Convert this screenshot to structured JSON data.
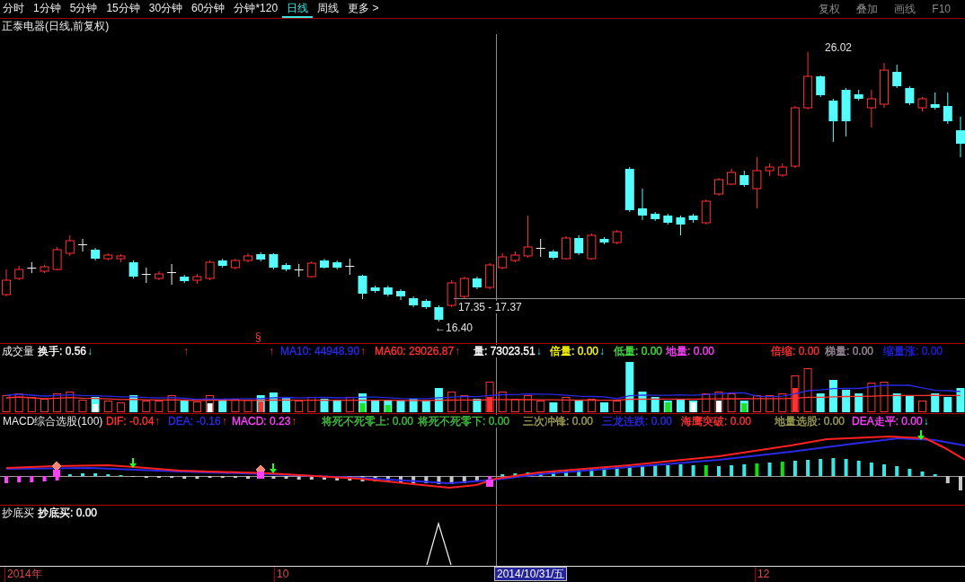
{
  "timeframe_tabs": [
    {
      "label": "分时",
      "selected": false
    },
    {
      "label": "1分钟",
      "selected": false
    },
    {
      "label": "5分钟",
      "selected": false
    },
    {
      "label": "15分钟",
      "selected": false
    },
    {
      "label": "30分钟",
      "selected": false
    },
    {
      "label": "60分钟",
      "selected": false
    },
    {
      "label": "分钟*120",
      "selected": false
    },
    {
      "label": "日线",
      "selected": true
    },
    {
      "label": "周线",
      "selected": false
    },
    {
      "label": "更多 >",
      "selected": false
    }
  ],
  "toolbar_buttons": [
    "复权",
    "叠加",
    "画线",
    "F10"
  ],
  "price_panel": {
    "title": "正泰电器(日线,前复权)",
    "high_label": "26.02",
    "crosshair_price": "17.35 - 17.37",
    "low_label": "←16.40",
    "signal_mark": "§"
  },
  "volume_panel": {
    "title": "成交量",
    "readouts": [
      {
        "kind": "value",
        "text": "换手: 0.56",
        "color": "#ffffff",
        "arrow": {
          "symbol": "↓",
          "rising": false
        }
      },
      {
        "kind": "marker",
        "arrow": {
          "symbol": "↑",
          "rising": true
        }
      },
      {
        "kind": "marker",
        "arrow": {
          "symbol": "↑",
          "rising": true
        }
      },
      {
        "kind": "value",
        "text": "MA10: 44948.90",
        "color": "#2a2ae6",
        "arrow": {
          "symbol": "↑",
          "rising": true
        }
      },
      {
        "kind": "value",
        "text": "MA60: 29026.87",
        "color": "#ff3232",
        "arrow": {
          "symbol": "↑",
          "rising": true
        }
      },
      {
        "kind": "value",
        "text": "量: 73023.51",
        "color": "#ffffff",
        "arrow": {
          "symbol": "↓",
          "rising": false
        }
      },
      {
        "kind": "value",
        "text": "倍量: 0.00",
        "color": "#ffff00",
        "arrow": {
          "symbol": "↓",
          "rising": false
        }
      },
      {
        "kind": "value",
        "text": "低量: 0.00",
        "color": "#40e040"
      },
      {
        "kind": "value",
        "text": "地量: 0.00",
        "color": "#ff40ff"
      },
      {
        "kind": "value",
        "text": "倍缩: 0.00",
        "color": "#ff3232"
      },
      {
        "kind": "value",
        "text": "梯量: 0.00",
        "color": "#9a8a9a"
      },
      {
        "kind": "value",
        "text": "缩量涨: 0.00",
        "color": "#2020d8"
      }
    ]
  },
  "macd_panel": {
    "title": "MACD综合选股(100)",
    "readouts": [
      {
        "kind": "value",
        "text": "DIF: -0.04",
        "color": "#ff3232",
        "arrow": {
          "symbol": "↑",
          "rising": true
        }
      },
      {
        "kind": "value",
        "text": "DEA: -0.16",
        "color": "#2a2ae6",
        "arrow": {
          "symbol": "↑",
          "rising": true
        }
      },
      {
        "kind": "value",
        "text": "MACD: 0.23",
        "color": "#ff40ff",
        "arrow": {
          "symbol": "↑",
          "rising": true
        }
      },
      {
        "kind": "value",
        "text": "将死不死零上: 0.00",
        "color": "#40c040"
      },
      {
        "kind": "value",
        "text": "将死不死零下: 0.00",
        "color": "#40c040"
      },
      {
        "kind": "value",
        "text": "三次冲锋: 0.00",
        "color": "#a0a050"
      },
      {
        "kind": "value",
        "text": "三龙连跌: 0.00",
        "color": "#2a2ae6"
      },
      {
        "kind": "value",
        "text": "海鹰突破: 0.00",
        "color": "#ff3232"
      },
      {
        "kind": "value",
        "text": "地量选股: 0.00",
        "color": "#a0a050"
      },
      {
        "kind": "value",
        "text": "DEA走平: 0.00",
        "color": "#ff40ff",
        "arrow": {
          "symbol": "↓",
          "rising": false
        }
      }
    ]
  },
  "bottom_panel": {
    "title": "抄底买",
    "readouts": [
      {
        "kind": "value",
        "text": "抄底买: 0.00",
        "color": "#ffffff"
      }
    ]
  },
  "time_axis": [
    {
      "label": "2014年",
      "selected": false
    },
    {
      "label": "10",
      "selected": false
    },
    {
      "label": "2014/10/31/五",
      "selected": true
    },
    {
      "label": "12",
      "selected": false
    }
  ]
}
